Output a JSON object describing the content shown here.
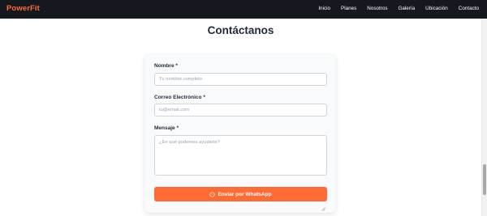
{
  "brand": "PowerFit",
  "nav": [
    "Inicio",
    "Planes",
    "Nosotros",
    "Galería",
    "Ubicación",
    "Contacto"
  ],
  "contact": {
    "title": "Contáctanos",
    "name_label": "Nombre *",
    "name_placeholder": "Tu nombre completo",
    "email_label": "Correo Electrónico *",
    "email_placeholder": "tu@email.com",
    "message_label": "Mensaje *",
    "message_placeholder": "¿En qué podemos ayudarte?",
    "submit_label": "Enviar por WhatsApp"
  },
  "colors": {
    "accent": "#ff6b35",
    "navbar": "#16181f"
  },
  "icons": {
    "submit": "whatsapp-icon"
  }
}
